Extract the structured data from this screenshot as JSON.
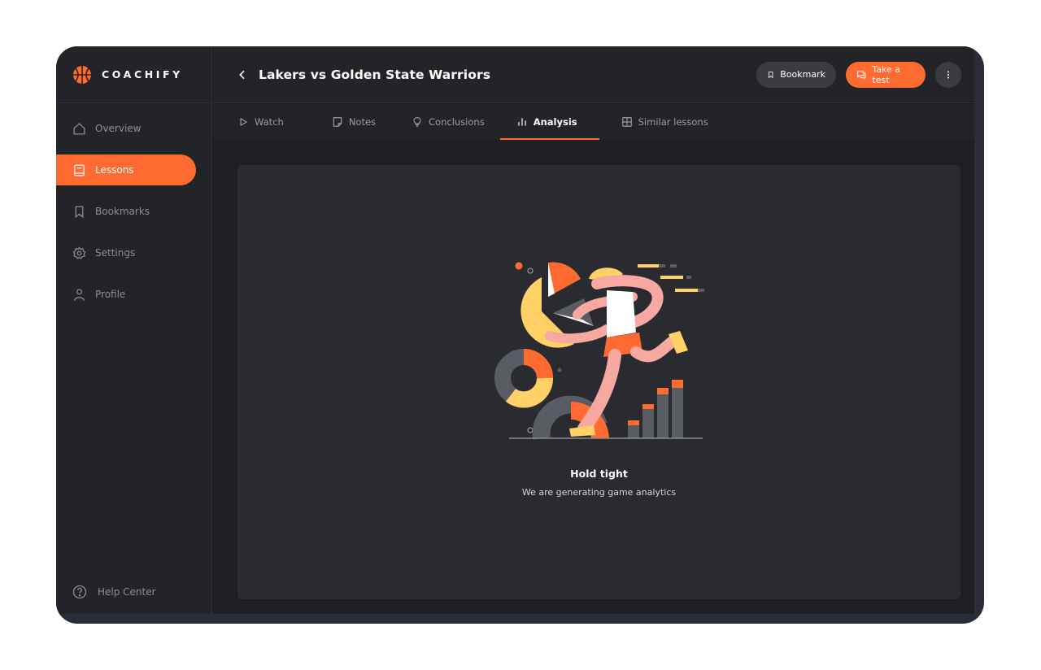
{
  "brand": {
    "name": "COACHIFY"
  },
  "sidebar": {
    "items": [
      {
        "label": "Overview",
        "icon": "home-icon",
        "active": false
      },
      {
        "label": "Lessons",
        "icon": "book-icon",
        "active": true
      },
      {
        "label": "Bookmarks",
        "icon": "bookmark-icon",
        "active": false
      },
      {
        "label": "Settings",
        "icon": "gear-icon",
        "active": false
      },
      {
        "label": "Profile",
        "icon": "user-icon",
        "active": false
      }
    ],
    "help": {
      "label": "Help Center",
      "icon": "question-icon"
    }
  },
  "header": {
    "title": "Lakers vs Golden State Warriors",
    "bookmark_label": "Bookmark",
    "test_label": "Take a test"
  },
  "tabs": [
    {
      "label": "Watch",
      "icon": "play-icon"
    },
    {
      "label": "Notes",
      "icon": "note-icon"
    },
    {
      "label": "Conclusions",
      "icon": "lightbulb-icon"
    },
    {
      "label": "Analysis",
      "icon": "bar-chart-icon",
      "active": true
    },
    {
      "label": "Similar lessons",
      "icon": "grid-icon"
    }
  ],
  "content": {
    "title": "Hold tight",
    "subtitle": "We are generating game analytics"
  },
  "colors": {
    "accent": "#ff6a30",
    "yellow": "#ffd166",
    "pink": "#f7a8a0",
    "background": "#1e1f22",
    "panel": "#232427",
    "card": "#2a2b30"
  }
}
